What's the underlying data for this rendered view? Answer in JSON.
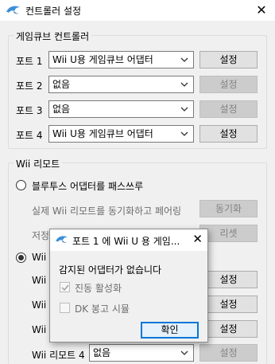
{
  "window": {
    "title": "컨트롤러 설정",
    "icon": "dolphin-icon",
    "close_icon": "close-icon"
  },
  "gc_group": {
    "title": "게임큐브 컨트롤러",
    "rows": [
      {
        "label": "포트 1",
        "value": "Wii U용 게임큐브 어댑터",
        "button": "설정",
        "button_enabled": true
      },
      {
        "label": "포트 2",
        "value": "없음",
        "button": "설정",
        "button_enabled": false
      },
      {
        "label": "포트 3",
        "value": "없음",
        "button": "설정",
        "button_enabled": false
      },
      {
        "label": "포트 4",
        "value": "Wii U용 게임큐브 어댑터",
        "button": "설정",
        "button_enabled": true
      }
    ]
  },
  "wii_group": {
    "title": "Wii 리모트",
    "passthrough_label": "블루투스 어댑터를 패스쓰루",
    "sync_text": "실제 Wii 리모트를 동기화하고 페어링",
    "sync_button": "동기화",
    "reset_text": "저정",
    "reset_button": "리셋",
    "emulated_label": "Wii",
    "remote_rows": [
      {
        "label": "Wii",
        "button": "설정"
      },
      {
        "label": "Wii",
        "button": "설정"
      },
      {
        "label": "Wii",
        "button": "설정"
      },
      {
        "label": "Wii 리모트 4",
        "value": "없음",
        "button": "설정"
      }
    ]
  },
  "popup": {
    "title": "포트 1 에 Wii U 용 게임...",
    "message": "감지된 어댑터가 없습니다",
    "checkbox1": "진동 활성화",
    "checkbox2": "DK 봉고 시뮬",
    "ok": "확인"
  },
  "colors": {
    "accent": "#0078d7",
    "dolphin": "#3d8fd6"
  }
}
